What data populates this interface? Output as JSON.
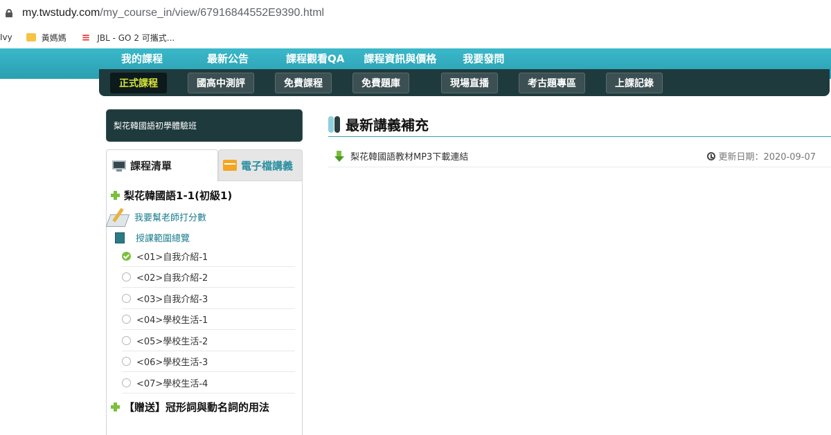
{
  "browser": {
    "url_host": "my.twstudy.com",
    "url_path": "/my_course_in/view/67916844552E9390.html",
    "bookmarks": [
      {
        "label": "Ivy",
        "icon": "none"
      },
      {
        "label": "黃媽媽",
        "icon": "folder-icon"
      },
      {
        "label": "JBL - GO 2 可攜式...",
        "icon": "jbl-icon"
      }
    ]
  },
  "nav": {
    "main": [
      "我的課程",
      "最新公告",
      "課程觀看QA",
      "課程資訊與價格",
      "我要發問"
    ],
    "sub": [
      "正式課程",
      "國高中測評",
      "免費課程",
      "免費題庫",
      "現場直播",
      "考古題專區",
      "上課記錄"
    ]
  },
  "sidebar": {
    "course_title": "梨花韓國語初學體驗班",
    "tabs": [
      "課程清單",
      "電子檔講義"
    ],
    "chapter1": "梨花韓國語1-1(初級1)",
    "rate_link": "我要幫老師打分數",
    "overview_link": "授課範圍總覽",
    "lessons": [
      {
        "label": "<01>自我介紹-1",
        "done": true
      },
      {
        "label": "<02>自我介紹-2",
        "done": false
      },
      {
        "label": "<03>自我介紹-3",
        "done": false
      },
      {
        "label": "<04>學校生活-1",
        "done": false
      },
      {
        "label": "<05>學校生活-2",
        "done": false
      },
      {
        "label": "<06>學校生活-3",
        "done": false
      },
      {
        "label": "<07>學校生活-4",
        "done": false
      }
    ],
    "chapter2": "【贈送】冠形詞與動名詞的用法"
  },
  "content": {
    "section_title": "最新講義補充",
    "download_link": "梨花韓國語教材MP3下載連結",
    "update_label": "更新日期：2020-09-07"
  },
  "colors": {
    "teal": "#2a9fb2",
    "dark": "#1f3a3d",
    "green": "#7cbf3b",
    "active_text": "#d7e43a"
  }
}
